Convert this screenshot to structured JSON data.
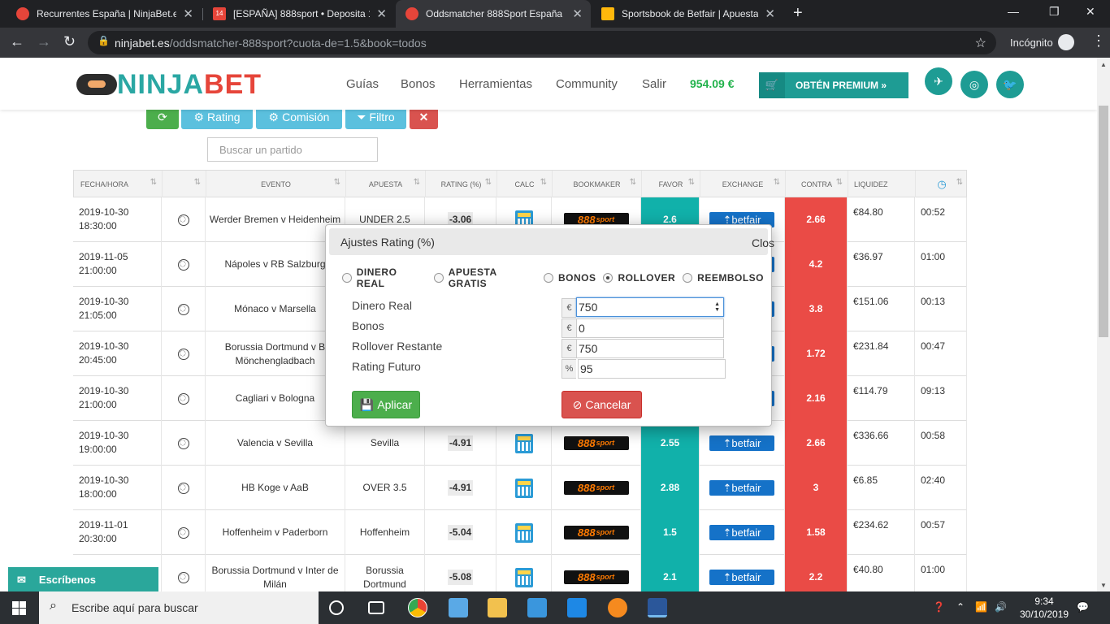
{
  "browser": {
    "tabs": [
      {
        "title": "Recurrentes España | NinjaBet.es",
        "close": "✕",
        "color": "#e6453a"
      },
      {
        "title": "[ESPAÑA] 888sport • Deposita 15",
        "close": "✕",
        "color": "#e6453a",
        "badge": "14"
      },
      {
        "title": "Oddsmatcher 888Sport España | ",
        "close": "✕",
        "color": "#e6453a"
      },
      {
        "title": "Sportsbook de Betfair | Apuesta ",
        "close": "✕",
        "color": "#ffb80c"
      }
    ],
    "new_tab": "+",
    "url_host": "ninjabet.es",
    "url_path": "/oddsmatcher-888sport?cuota-de=1.5&book=todos",
    "incognito_label": "Incógnito"
  },
  "site": {
    "logo_a": "NINJA",
    "logo_b": "BET",
    "nav": [
      "Guías",
      "Bonos",
      "Herramientas",
      "Community",
      "Salir"
    ],
    "balance": "954.09 €",
    "premium_label": "OBTÉN PREMIUM »",
    "colors": {
      "teal": "#1e9c94",
      "red": "#e6453a",
      "green": "#21b24b"
    }
  },
  "filters": {
    "buttons": [
      {
        "label": "",
        "icon": "refresh-icon"
      },
      {
        "label": "Rating",
        "icon": "gears-icon"
      },
      {
        "label": "Comisión",
        "icon": "gears-icon"
      },
      {
        "label": "Filtro",
        "icon": "filter-icon"
      },
      {
        "label": "",
        "icon": "close-icon"
      }
    ],
    "search_placeholder": "Buscar un partido"
  },
  "table": {
    "headers": [
      "FECHA/HORA",
      "",
      "EVENTO",
      "APUESTA",
      "RATING (%)",
      "CALC",
      "BOOKMAKER",
      "FAVOR",
      "EXCHANGE",
      "CONTRA",
      "LIQUIDEZ",
      ""
    ],
    "bookmaker": {
      "big": "888",
      "small": "sport"
    },
    "exchange_label": "betfair",
    "rows": [
      {
        "date": "2019-10-30",
        "time": "18:30:00",
        "event": "Werder Bremen v Heidenheim",
        "bet": "UNDER 2.5",
        "rating": "-3.06",
        "favor": "2.6",
        "contra": "2.66",
        "liq": "€84.80",
        "left": "00:52"
      },
      {
        "date": "2019-11-05",
        "time": "21:00:00",
        "event": "Nápoles v RB Salzburg",
        "bet": "",
        "rating": "",
        "favor": "",
        "contra": "4.2",
        "liq": "€36.97",
        "left": "01:00"
      },
      {
        "date": "2019-10-30",
        "time": "21:05:00",
        "event": "Mónaco v Marsella",
        "bet": "",
        "rating": "",
        "favor": "",
        "contra": "3.8",
        "liq": "€151.06",
        "left": "00:13"
      },
      {
        "date": "2019-10-30",
        "time": "20:45:00",
        "event": "Borussia Dortmund v B Mönchengladbach",
        "bet": "",
        "rating": "",
        "favor": "",
        "contra": "1.72",
        "liq": "€231.84",
        "left": "00:47"
      },
      {
        "date": "2019-10-30",
        "time": "21:00:00",
        "event": "Cagliari v Bologna",
        "bet": "",
        "rating": "",
        "favor": "",
        "contra": "2.16",
        "liq": "€114.79",
        "left": "09:13"
      },
      {
        "date": "2019-10-30",
        "time": "19:00:00",
        "event": "Valencia v Sevilla",
        "bet": "Sevilla",
        "rating": "-4.91",
        "favor": "2.55",
        "contra": "2.66",
        "liq": "€336.66",
        "left": "00:58"
      },
      {
        "date": "2019-10-30",
        "time": "18:00:00",
        "event": "HB Koge v AaB",
        "bet": "OVER 3.5",
        "rating": "-4.91",
        "favor": "2.88",
        "contra": "3",
        "liq": "€6.85",
        "left": "02:40"
      },
      {
        "date": "2019-11-01",
        "time": "20:30:00",
        "event": "Hoffenheim v Paderborn",
        "bet": "Hoffenheim",
        "rating": "-5.04",
        "favor": "1.5",
        "contra": "1.58",
        "liq": "€234.62",
        "left": "00:57"
      },
      {
        "date": "",
        "time": "",
        "event": "Borussia Dortmund v Inter de Milán",
        "bet": "Borussia Dortmund",
        "rating": "-5.08",
        "favor": "2.1",
        "contra": "2.2",
        "liq": "€40.80",
        "left": "01:00"
      }
    ]
  },
  "modal": {
    "title": "Ajustes Rating (%)",
    "close": "Clos",
    "radios": [
      {
        "label": "DINERO REAL",
        "checked": false
      },
      {
        "label": "APUESTA GRATIS",
        "checked": false
      },
      {
        "label": "BONOS",
        "checked": false
      },
      {
        "label": "ROLLOVER",
        "checked": true
      },
      {
        "label": "REEMBOLSO",
        "checked": false
      }
    ],
    "fields": [
      {
        "label": "Dinero Real",
        "prefix": "€",
        "value": "750"
      },
      {
        "label": "Bonos",
        "prefix": "€",
        "value": "0"
      },
      {
        "label": "Rollover Restante",
        "prefix": "€",
        "value": "750"
      },
      {
        "label": "Rating Futuro",
        "prefix": "%",
        "value": "95"
      }
    ],
    "apply_label": "Aplicar",
    "cancel_label": "Cancelar"
  },
  "chat": {
    "label": "Escríbenos"
  },
  "taskbar": {
    "search_text": "Escribe aquí para buscar",
    "time": "9:34",
    "date": "30/10/2019"
  }
}
